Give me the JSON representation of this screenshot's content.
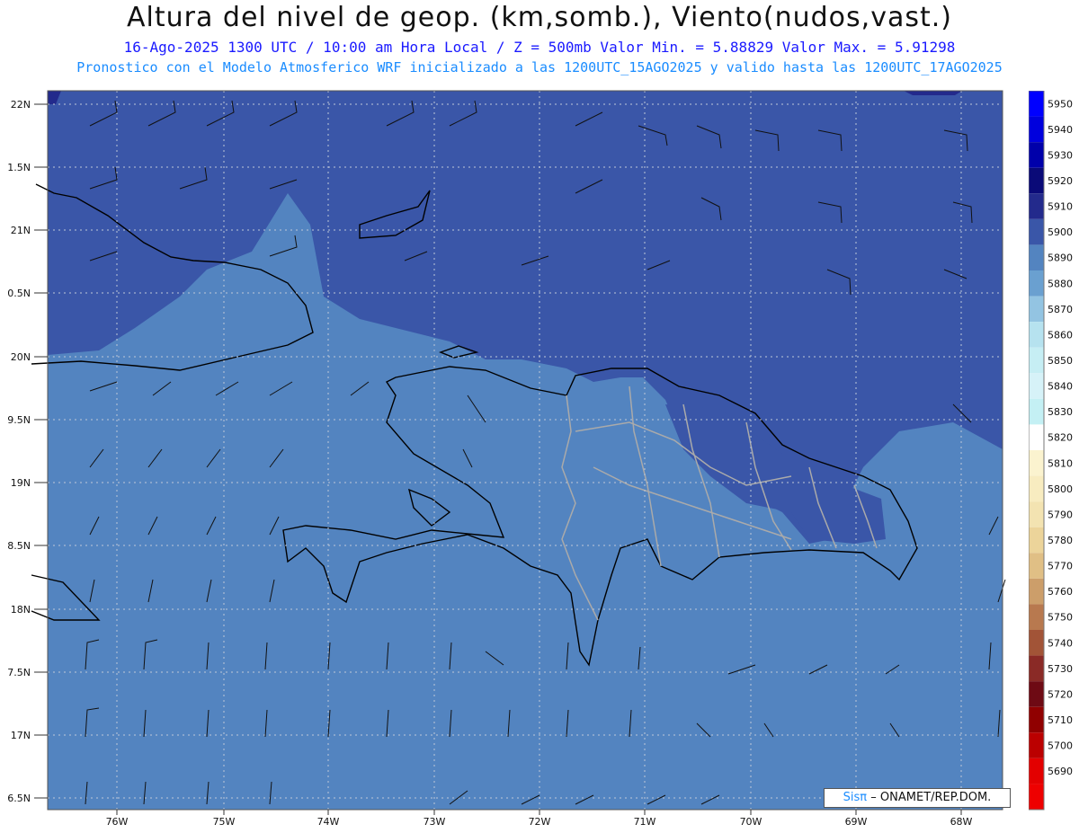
{
  "header": {
    "title": "Altura del nivel de geop. (km,somb.), Viento(nudos,vast.)",
    "subtitle_line1": "16-Ago-2025  1300 UTC / 10:00 am Hora Local / Z = 500mb   Valor Min. = 5.88829  Valor Max. = 5.91298",
    "subtitle_line2": "Pronostico con el Modelo Atmosferico WRF inicializado a las 1200UTC_15AGO2025 y valido hasta las  1200UTC_17AGO2025"
  },
  "axes": {
    "lat_labels": [
      "22N",
      "1.5N",
      "21N",
      "0.5N",
      "20N",
      "9.5N",
      "19N",
      "8.5N",
      "18N",
      "7.5N",
      "17N",
      "6.5N"
    ],
    "lon_labels": [
      "76W",
      "75W",
      "74W",
      "73W",
      "72W",
      "71W",
      "70W",
      "69W",
      "68W"
    ]
  },
  "colorbar": {
    "levels": [
      "5950",
      "5940",
      "5930",
      "5920",
      "5910",
      "5900",
      "5890",
      "5880",
      "5870",
      "5860",
      "5850",
      "5840",
      "5830",
      "5820",
      "5810",
      "5800",
      "5790",
      "5780",
      "5770",
      "5760",
      "5750",
      "5740",
      "5730",
      "5720",
      "5710",
      "5700",
      "5690"
    ],
    "colors": [
      "#0000ff",
      "#0000dd",
      "#0000aa",
      "#0a0a78",
      "#232a8c",
      "#3a56a8",
      "#5384c0",
      "#6aa0d0",
      "#93c4e2",
      "#b6e2ef",
      "#c6eef4",
      "#d6f2f8",
      "#c4f0f4",
      "#ffffff",
      "#fbf3cf",
      "#f8ecc0",
      "#f3e3b1",
      "#ecd49a",
      "#e0bf85",
      "#cc9e6a",
      "#b8794f",
      "#a25437",
      "#8a2a26",
      "#6e0a14",
      "#900000",
      "#bb0000",
      "#e30000"
    ],
    "bottom_color": "#ee0000"
  },
  "map_colors": {
    "high": "#3a56a8",
    "mid": "#5384c0",
    "top_dark": "#232a8c"
  },
  "credit": {
    "brand": "Sisπ",
    "text": "– ONAMET/REP.DOM."
  }
}
